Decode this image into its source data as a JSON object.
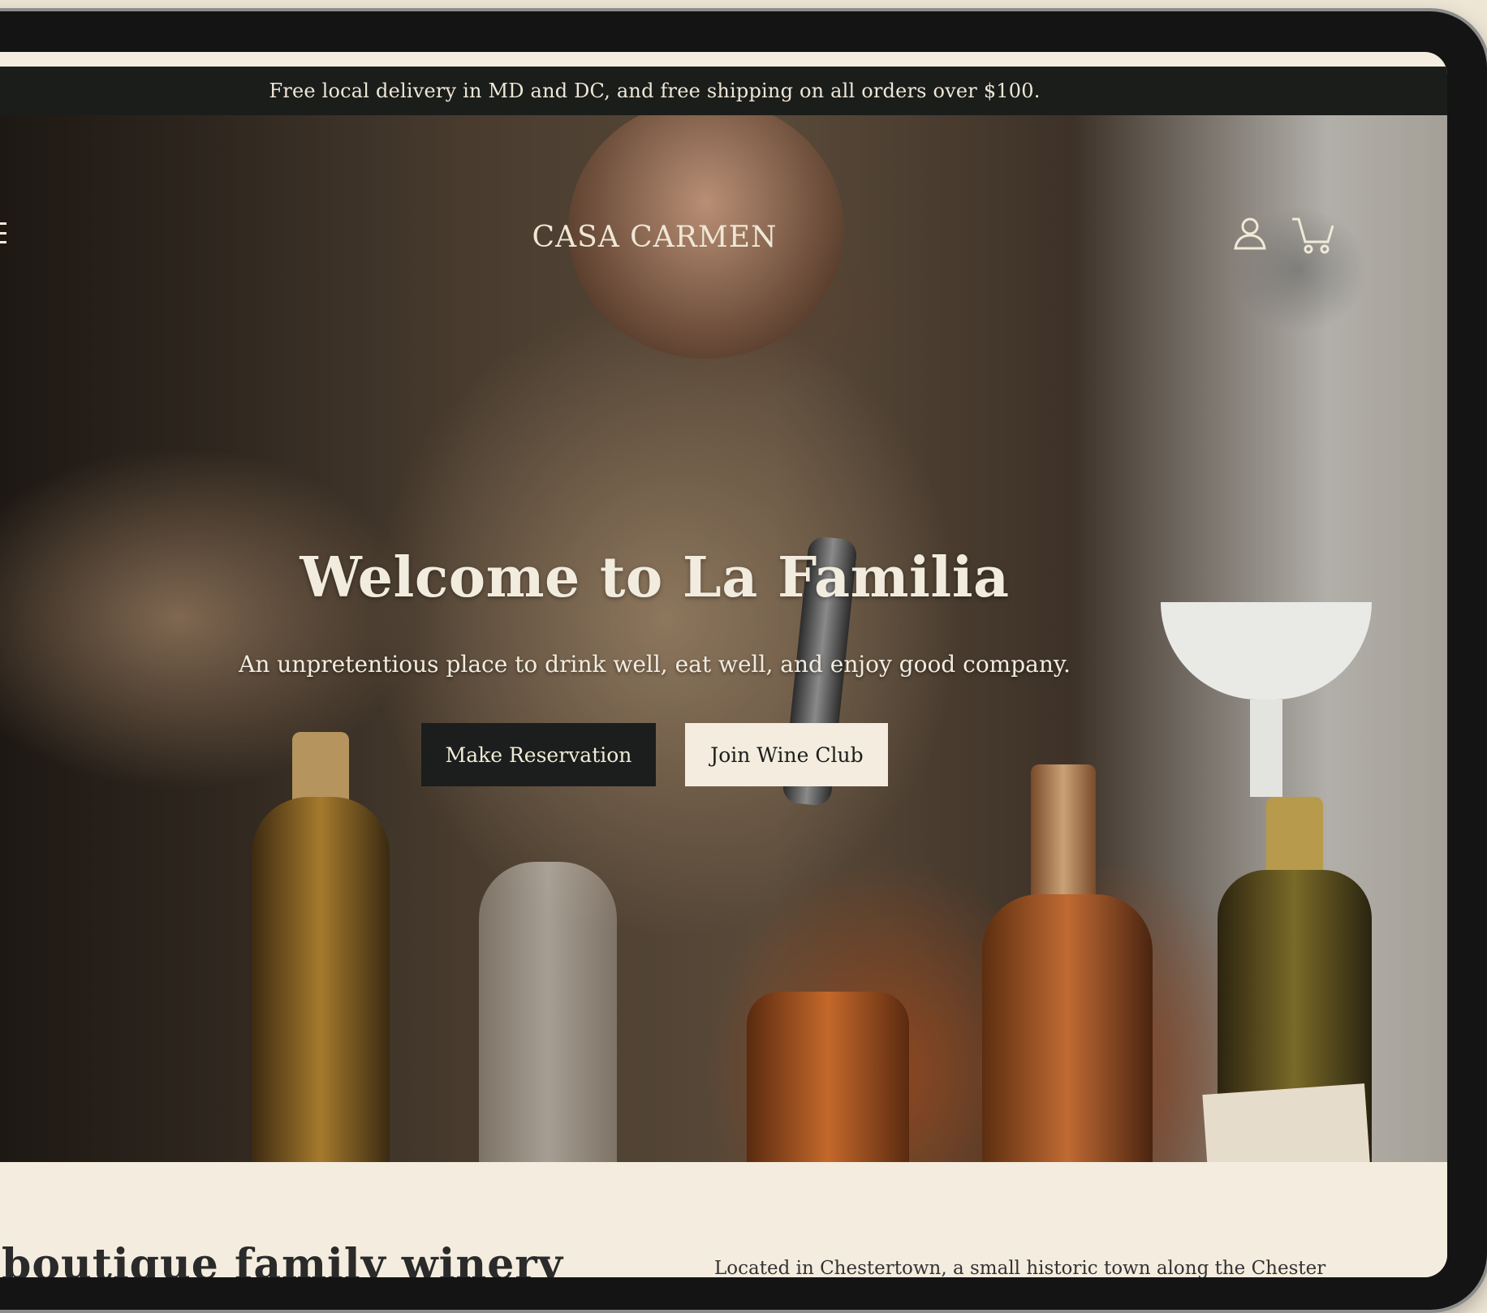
{
  "announcement": {
    "text": "Free local delivery in MD and DC, and free shipping on all orders over $100."
  },
  "header": {
    "brand": "CASA CARMEN",
    "icons": {
      "menu": "hamburger-menu-icon",
      "account": "account-icon",
      "cart": "cart-icon"
    }
  },
  "hero": {
    "title": "Welcome to La Familia",
    "subtitle": "An unpretentious place to drink well, eat well, and enjoy good company.",
    "primary_button": "Make Reservation",
    "secondary_button": "Join Wine Club"
  },
  "about": {
    "heading": "boutique family winery",
    "text": "Located in Chestertown, a small historic town along the Chester"
  },
  "colors": {
    "announcement_bg": "#1b1d1b",
    "page_bg": "#f4ecde",
    "button_dark": "#1b1e1c",
    "button_light": "#f4ecde",
    "text_light": "#f0ead8"
  }
}
